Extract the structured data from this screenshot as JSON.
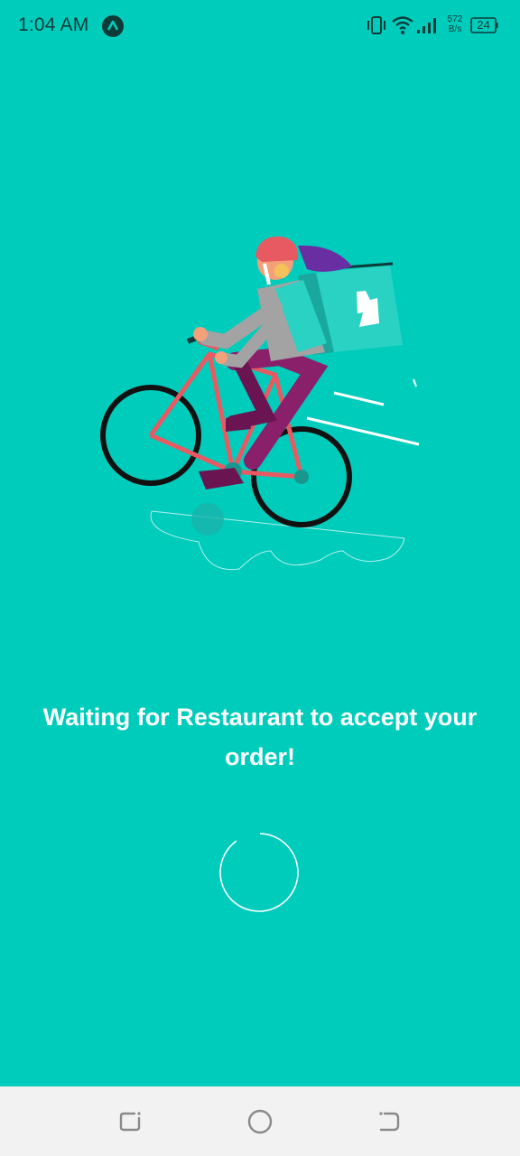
{
  "status_bar": {
    "time": "1:04 AM",
    "net_speed_value": "572",
    "net_speed_unit": "B/s",
    "battery_level": "24",
    "icons": [
      "app-notification-icon",
      "vibrate-icon",
      "wifi-icon",
      "cellular-signal-icon",
      "battery-icon"
    ]
  },
  "illustration": {
    "description_icon": "courier-cyclist-illustration",
    "brand_color": "#00CCBC"
  },
  "main": {
    "message": "Waiting for Restaurant to accept your order!",
    "loading_indicator": "spinner-icon"
  },
  "nav_bar": {
    "icons": [
      "recents-icon",
      "home-icon",
      "back-icon"
    ]
  }
}
